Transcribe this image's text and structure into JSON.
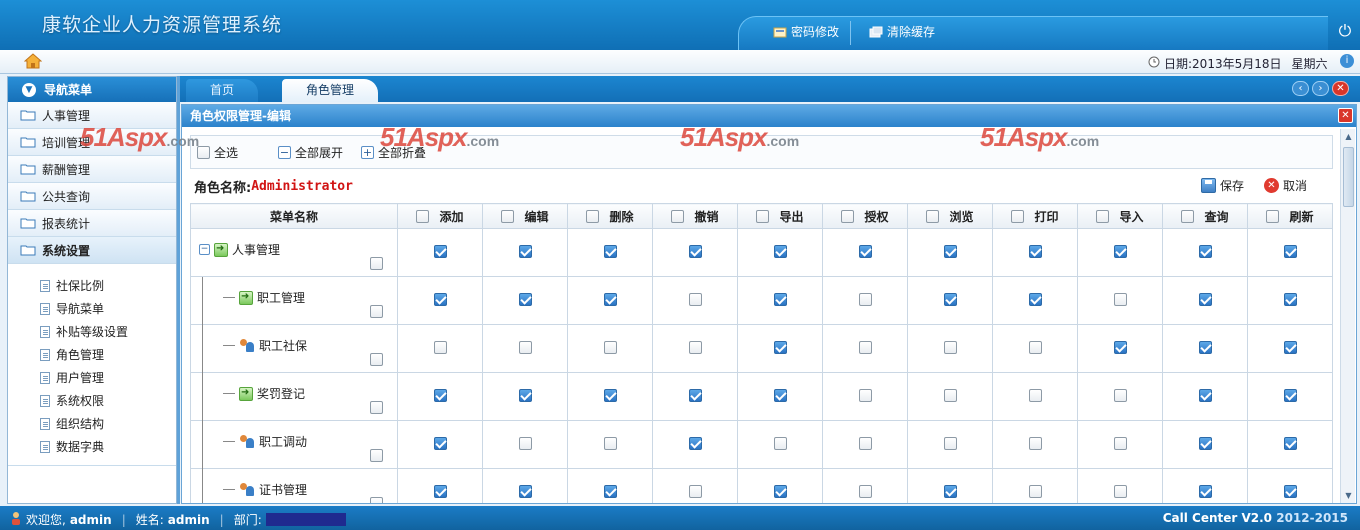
{
  "header": {
    "title": "康软企业人力资源管理系统",
    "tools": [
      {
        "label": "密码修改",
        "icon": "key-icon"
      },
      {
        "label": "清除缓存",
        "icon": "clear-cache-icon"
      }
    ]
  },
  "infobar": {
    "date": "日期:2013年5月18日",
    "weekday": "星期六"
  },
  "sidebar": {
    "title": "导航菜单",
    "items": [
      {
        "label": "人事管理"
      },
      {
        "label": "培训管理"
      },
      {
        "label": "薪酬管理"
      },
      {
        "label": "公共查询"
      },
      {
        "label": "报表统计"
      },
      {
        "label": "系统设置"
      }
    ],
    "sub_items": [
      {
        "label": "社保比例"
      },
      {
        "label": "导航菜单"
      },
      {
        "label": "补贴等级设置"
      },
      {
        "label": "角色管理"
      },
      {
        "label": "用户管理"
      },
      {
        "label": "系统权限"
      },
      {
        "label": "组织结构"
      },
      {
        "label": "数据字典"
      }
    ]
  },
  "tabs": [
    {
      "label": "首页",
      "active": false
    },
    {
      "label": "角色管理",
      "active": true
    }
  ],
  "dialog": {
    "title": "角色权限管理-编辑",
    "toolbar": {
      "select_all": "全选",
      "expand_all": "全部展开",
      "collapse_all": "全部折叠"
    },
    "role_label": "角色名称:",
    "role_name": "Administrator",
    "save_label": "保存",
    "cancel_label": "取消"
  },
  "table": {
    "name_header": "菜单名称",
    "columns": [
      "添加",
      "编辑",
      "删除",
      "撤销",
      "导出",
      "授权",
      "浏览",
      "打印",
      "导入",
      "查询",
      "刷新"
    ],
    "rows": [
      {
        "name": "人事管理",
        "level": 0,
        "icon": "arrow-icon",
        "checks": [
          true,
          true,
          true,
          true,
          true,
          true,
          true,
          true,
          true,
          true,
          true
        ]
      },
      {
        "name": "职工管理",
        "level": 1,
        "icon": "arrow-icon",
        "checks": [
          true,
          true,
          true,
          false,
          true,
          false,
          true,
          true,
          false,
          true,
          true
        ]
      },
      {
        "name": "职工社保",
        "level": 1,
        "icon": "people-icon",
        "checks": [
          false,
          false,
          false,
          false,
          true,
          false,
          false,
          false,
          true,
          true,
          true
        ]
      },
      {
        "name": "奖罚登记",
        "level": 1,
        "icon": "arrow-icon",
        "checks": [
          true,
          true,
          true,
          true,
          true,
          false,
          false,
          false,
          false,
          true,
          true
        ]
      },
      {
        "name": "职工调动",
        "level": 1,
        "icon": "people-icon",
        "checks": [
          true,
          false,
          false,
          true,
          false,
          false,
          false,
          false,
          false,
          true,
          true
        ]
      },
      {
        "name": "证书管理",
        "level": 1,
        "icon": "people-icon",
        "checks": [
          true,
          true,
          true,
          false,
          true,
          false,
          true,
          false,
          false,
          true,
          true
        ]
      }
    ]
  },
  "watermark": {
    "main": "51Aspx",
    "suffix": ".com"
  },
  "status": {
    "welcome_label": "欢迎您,",
    "welcome_user": "admin",
    "name_label": "姓名:",
    "name_value": "admin",
    "dept_label": "部门:",
    "product": "Call Center V2.0",
    "years": "2012-2015"
  }
}
